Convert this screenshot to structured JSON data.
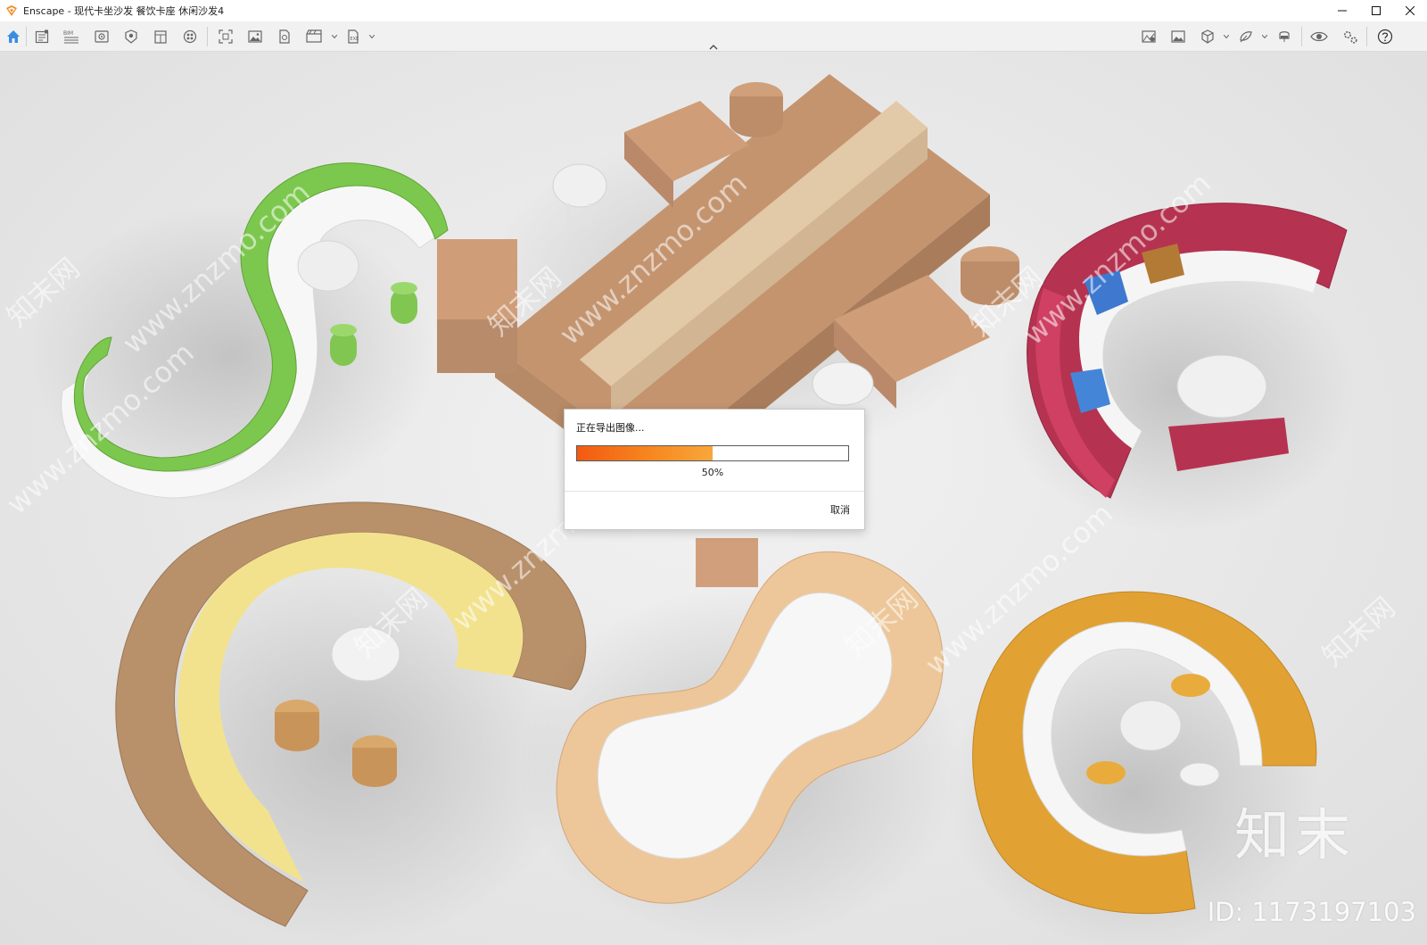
{
  "window": {
    "app_name": "Enscape",
    "title": "Enscape - 现代卡坐沙发 餐饮卡座 休闲沙发4",
    "controls": [
      "minimize-icon",
      "maximize-icon",
      "close-icon"
    ]
  },
  "toolbar": {
    "left_icons": [
      "home-icon",
      "views-icon",
      "bim-icon",
      "visual-settings-icon",
      "asset-library-icon",
      "material-editor-icon",
      "atmosphere-icon",
      "screenshot-icon",
      "render-image-icon",
      "panorama-icon",
      "video-icon",
      "export-icon"
    ],
    "right_icons": [
      "batch-render-icon",
      "render-gallery-icon",
      "vr-icon",
      "sync-icon",
      "vr-headset-icon",
      "visibility-icon",
      "settings-icon",
      "help-icon"
    ],
    "bim_label": "BIM"
  },
  "dialog": {
    "title": "正在导出图像...",
    "progress": 0.5,
    "progress_label": "50%",
    "cancel_label": "取消"
  },
  "watermark": {
    "text": "www.znzmo.com",
    "brand": "知末",
    "brand_cn": "知末网",
    "id_label": "ID: 1173197103"
  },
  "colors": {
    "accent": "#3a8de0",
    "progress_start": "#f25a12",
    "progress_end": "#f8a73b",
    "sofa_green": "#7cc84e",
    "sofa_wood": "#c99a76",
    "sofa_red": "#b53350",
    "sofa_tan": "#b8906a",
    "sofa_peach": "#edc79a",
    "sofa_mustard": "#e1a233"
  }
}
